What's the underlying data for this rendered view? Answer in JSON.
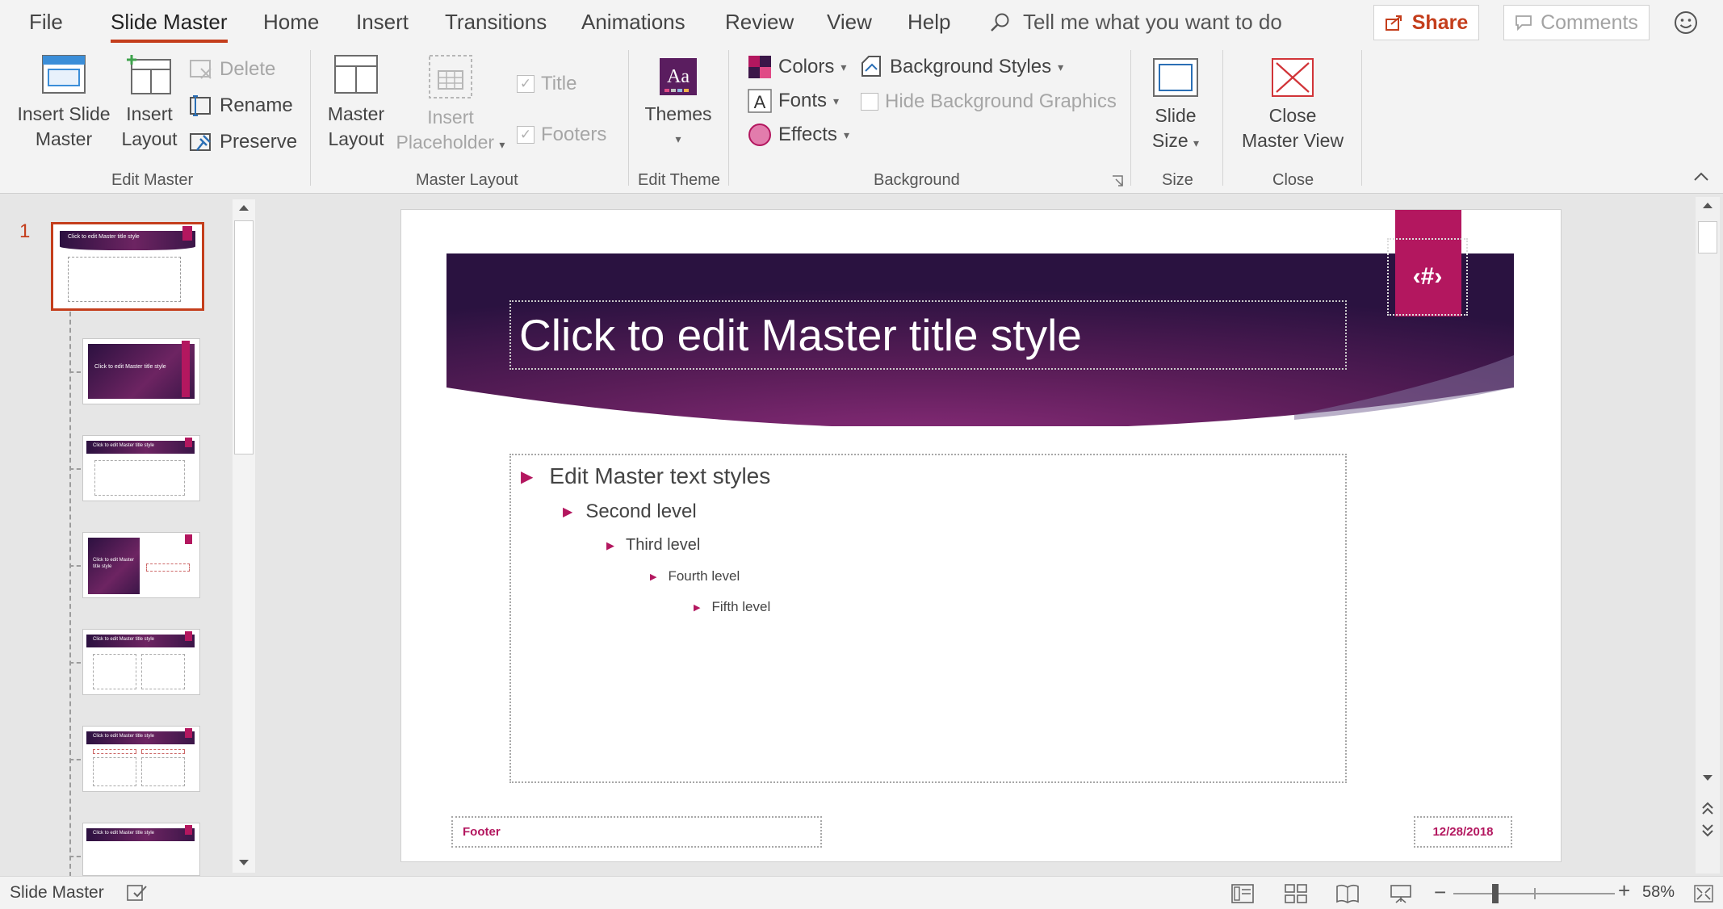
{
  "menu": {
    "tabs": [
      {
        "label": "File"
      },
      {
        "label": "Slide Master"
      },
      {
        "label": "Home"
      },
      {
        "label": "Insert"
      },
      {
        "label": "Transitions"
      },
      {
        "label": "Animations"
      },
      {
        "label": "Review"
      },
      {
        "label": "View"
      },
      {
        "label": "Help"
      }
    ],
    "search_placeholder": "Tell me what you want to do",
    "share_label": "Share",
    "comments_label": "Comments"
  },
  "ribbon": {
    "edit_master": {
      "group_label": "Edit Master",
      "insert_slide_master": "Insert Slide Master",
      "insert_slide_master_l1": "Insert Slide",
      "insert_slide_master_l2": "Master",
      "insert_layout_l1": "Insert",
      "insert_layout_l2": "Layout",
      "delete": "Delete",
      "rename": "Rename",
      "preserve": "Preserve"
    },
    "master_layout": {
      "group_label": "Master Layout",
      "master_layout_l1": "Master",
      "master_layout_l2": "Layout",
      "insert_placeholder_l1": "Insert",
      "insert_placeholder_l2": "Placeholder",
      "title": "Title",
      "footers": "Footers"
    },
    "edit_theme": {
      "group_label": "Edit Theme",
      "themes": "Themes"
    },
    "background": {
      "group_label": "Background",
      "colors": "Colors",
      "fonts": "Fonts",
      "effects": "Effects",
      "background_styles": "Background Styles",
      "hide_background_graphics": "Hide Background Graphics"
    },
    "size": {
      "group_label": "Size",
      "slide_size_l1": "Slide",
      "slide_size_l2": "Size"
    },
    "close": {
      "group_label": "Close",
      "close_master_view_l1": "Close",
      "close_master_view_l2": "Master View"
    }
  },
  "thumbnails": {
    "master_number": "1",
    "master_title": "Click to edit Master title style",
    "layouts": [
      {
        "title": "Click to edit Master title style"
      },
      {
        "title": "Click to edit Master title style"
      },
      {
        "title": "Click to edit Master title style"
      },
      {
        "title": "Click to edit Master title style"
      },
      {
        "title": "Click to edit Master title style"
      },
      {
        "title": "Click to edit Master title style"
      }
    ]
  },
  "slide": {
    "title": "Click to edit Master title style",
    "slide_number": "‹#›",
    "levels": [
      {
        "text": "Edit Master text styles"
      },
      {
        "text": "Second level"
      },
      {
        "text": "Third level"
      },
      {
        "text": "Fourth level"
      },
      {
        "text": "Fifth level"
      }
    ],
    "footer": "Footer",
    "date": "12/28/2018"
  },
  "status": {
    "view_label": "Slide Master",
    "zoom": "58%"
  },
  "colors": {
    "accent": "#c43e1c",
    "theme_magenta": "#b3175f",
    "banner_dark": "#3b1648",
    "banner_mid": "#6d2462"
  }
}
